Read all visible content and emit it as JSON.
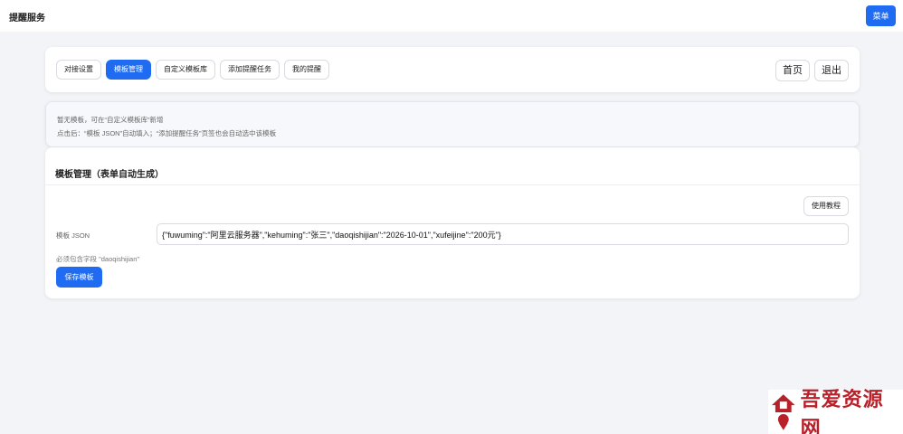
{
  "header": {
    "title": "提醒服务",
    "menu_label": "菜单"
  },
  "nav": {
    "tabs": [
      {
        "label": "对接设置",
        "active": false
      },
      {
        "label": "模板管理",
        "active": true
      },
      {
        "label": "自定义模板库",
        "active": false
      },
      {
        "label": "添加提醒任务",
        "active": false
      },
      {
        "label": "我的提醒",
        "active": false
      }
    ],
    "home_label": "首页",
    "logout_label": "退出"
  },
  "notice": {
    "line1": "暂无模板，可在“自定义模板库”新增",
    "line2": "点击后：“模板 JSON”自动填入；“添加提醒任务”页签也会自动选中该模板"
  },
  "template_section": {
    "title": "模板管理（表单自动生成）",
    "tutorial_label": "使用教程",
    "json_label": "模板 JSON",
    "json_value": "{\"fuwuming\":\"阿里云服务器\",\"kehuming\":\"张三\",\"daoqishijian\":\"2026-10-01\",\"xufeijine\":\"200元\"}",
    "required_hint": "必须包含字段 \"daoqishijian\"",
    "save_label": "保存模板"
  },
  "watermark": {
    "text": "吾爱资源网"
  },
  "colors": {
    "primary": "#1f6cf2",
    "background": "#f3f4f7",
    "watermark": "#b8202a"
  }
}
